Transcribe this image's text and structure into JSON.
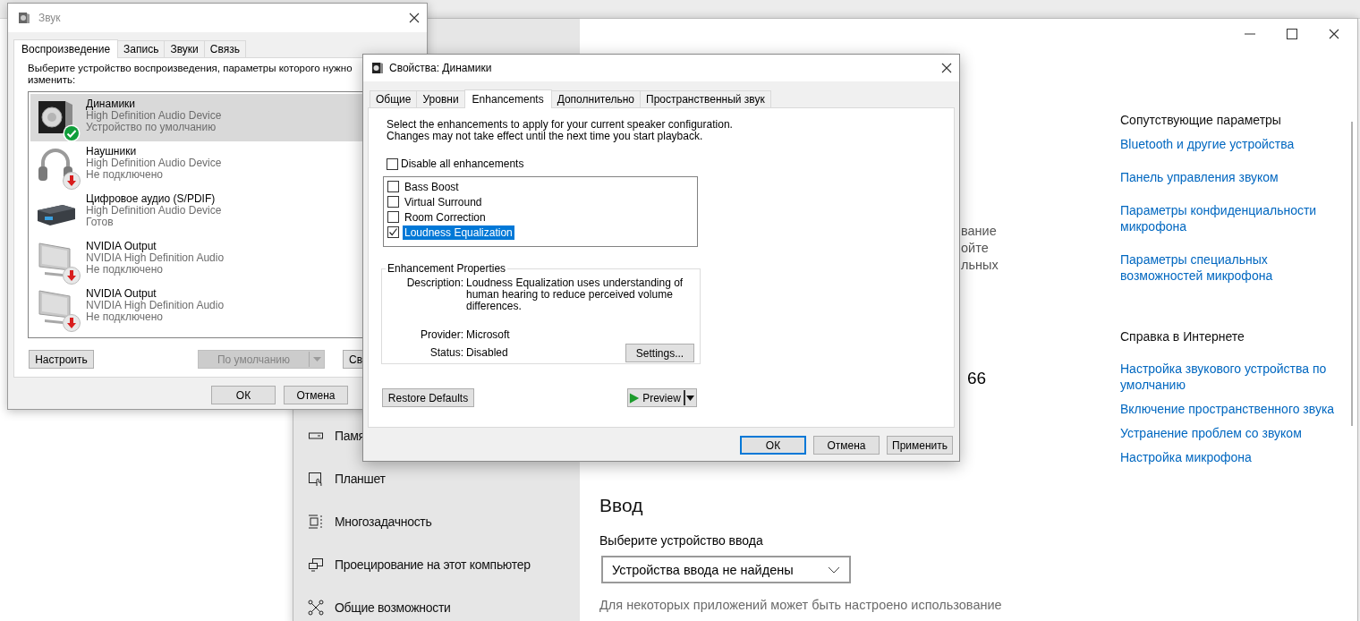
{
  "sound_dialog": {
    "title": "Звук",
    "tabs": [
      {
        "label": "Воспроизведение",
        "selected": true
      },
      {
        "label": "Запись",
        "selected": false
      },
      {
        "label": "Звуки",
        "selected": false
      },
      {
        "label": "Связь",
        "selected": false
      }
    ],
    "instruction": "Выберите устройство воспроизведения, параметры которого нужно изменить:",
    "devices": [
      {
        "kind": "speaker",
        "name": "Динамики",
        "driver": "High Definition Audio Device",
        "status": "Устройство по умолчанию",
        "default": true,
        "connected": true,
        "selected": true
      },
      {
        "kind": "headphones",
        "name": "Наушники",
        "driver": "High Definition Audio Device",
        "status": "Не подключено",
        "default": false,
        "connected": false,
        "selected": false
      },
      {
        "kind": "spdif",
        "name": "Цифровое аудио (S/PDIF)",
        "driver": "High Definition Audio Device",
        "status": "Готов",
        "default": false,
        "connected": true,
        "selected": false
      },
      {
        "kind": "monitor",
        "name": "NVIDIA Output",
        "driver": "NVIDIA High Definition Audio",
        "status": "Не подключено",
        "default": false,
        "connected": false,
        "selected": false
      },
      {
        "kind": "monitor",
        "name": "NVIDIA Output",
        "driver": "NVIDIA High Definition Audio",
        "status": "Не подключено",
        "default": false,
        "connected": false,
        "selected": false
      }
    ],
    "configure_button": "Настроить",
    "default_button": {
      "label": "По умолчанию",
      "disabled": true
    },
    "properties_button": "Св",
    "footer_buttons": [
      "ОК",
      "Отмена"
    ]
  },
  "properties_dialog": {
    "title": "Свойства: Динамики",
    "tabs": [
      {
        "label": "Общие",
        "selected": false
      },
      {
        "label": "Уровни",
        "selected": false
      },
      {
        "label": "Enhancements",
        "selected": true
      },
      {
        "label": "Дополнительно",
        "selected": false
      },
      {
        "label": "Пространственный звук",
        "selected": false
      }
    ],
    "intro": "Select the enhancements to apply for your current speaker configuration. Changes may not take effect until the next time you start playback.",
    "disable_all": {
      "label": "Disable all enhancements",
      "checked": false
    },
    "enhancements": [
      {
        "label": "Bass Boost",
        "checked": false,
        "selected": false
      },
      {
        "label": "Virtual Surround",
        "checked": false,
        "selected": false
      },
      {
        "label": "Room Correction",
        "checked": false,
        "selected": false
      },
      {
        "label": "Loudness Equalization",
        "checked": true,
        "selected": true
      }
    ],
    "group_title": "Enhancement Properties",
    "properties": [
      {
        "label": "Description:",
        "value": "Loudness Equalization uses understanding of human hearing to reduce perceived volume differences."
      },
      {
        "label": "Provider:",
        "value": "Microsoft"
      },
      {
        "label": "Status:",
        "value": "Disabled"
      }
    ],
    "settings_button": "Settings...",
    "restore_button": "Restore Defaults",
    "preview_button": "Preview",
    "buttons": [
      {
        "label": "ОК",
        "default": true
      },
      {
        "label": "Отмена",
        "default": false
      },
      {
        "label": "Применить",
        "default": false
      }
    ]
  },
  "settings_window": {
    "sidebar": {
      "items": [
        {
          "kind": "storage",
          "label": "Памя"
        },
        {
          "kind": "tablet",
          "label": "Планшет"
        },
        {
          "kind": "multitask",
          "label": "Многозадачность"
        },
        {
          "kind": "project",
          "label": "Проецирование на этот компьютер"
        },
        {
          "kind": "shared",
          "label": "Общие возможности"
        }
      ]
    },
    "text_fragments": [
      "вание",
      "ойте",
      "льных"
    ],
    "value": "66",
    "input": {
      "heading": "Ввод",
      "label": "Выберите устройство ввода",
      "dropdown": "Устройства ввода не найдены",
      "note": "Для некоторых приложений может быть настроено использование"
    },
    "related": [
      {
        "heading": "Сопутствующие параметры",
        "links": [
          "Bluetooth и другие устройства",
          "Панель управления звуком",
          "Параметры конфиденциальности микрофона",
          "Параметры специальных возможностей микрофона"
        ]
      },
      {
        "heading": "Справка в Интернете",
        "links": [
          "Настройка звукового устройства по умолчанию",
          "Включение пространственного звука",
          "Устранение проблем со звуком",
          "Настройка микрофона"
        ]
      }
    ]
  }
}
